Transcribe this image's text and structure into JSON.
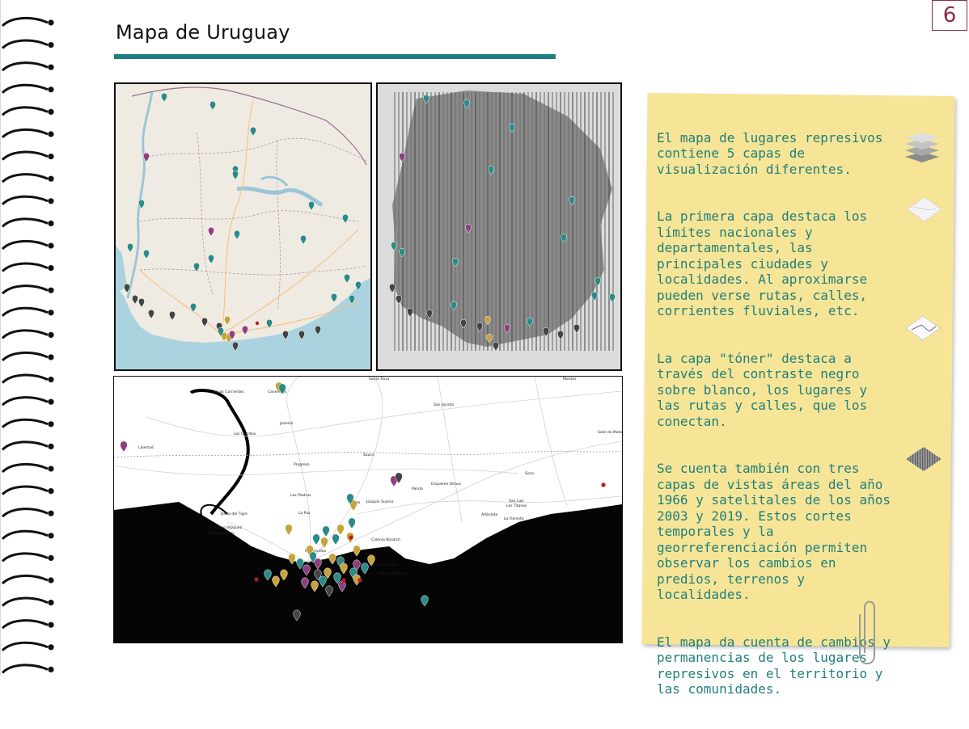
{
  "header": {
    "title": "Mapa de Uruguay",
    "page_number": "6"
  },
  "colors": {
    "accent_teal": "#1f8080",
    "page_number_border": "#8a2c4a",
    "note_background": "#f7e597",
    "note_text": "#1f7f7c",
    "marker_teal": "#2b8b88",
    "marker_purple": "#8e3f7f",
    "marker_gold": "#c8a23a",
    "marker_dark": "#444444"
  },
  "maps": {
    "dark_map_labels": {
      "santa_rosa": "Santa Rosa",
      "montes": "Montes",
      "aguas_corrientes": "Aguas Corrientes",
      "canelones": "Canelones",
      "san_jacinto": "San Jacinto",
      "joanico": "Joanicó",
      "los_cerrillos": "Los Cerrillos",
      "libertad": "Libertad",
      "sauce": "Sauce",
      "soltaDeMatas": "Solís de Mataojo",
      "progreso": "Progreso",
      "empalme_olmos": "Empalme Olmos",
      "pando": "Pando",
      "soca": "Soca",
      "las_piedras": "Las Piedras",
      "joaquin_suarez": "Joaquín Suárez",
      "toledo": "Toledo",
      "la_paz": "La Paz",
      "san_luis": "San Luis",
      "los_titanes": "Los Titanes",
      "delta_del_tigre": "Delta del Tigre",
      "santiago_vazquez": "Santiago Vázquez",
      "pajas_blancas": "Pajas Blancas",
      "atlantida": "Atlántida",
      "la_floresta": "La Floresta",
      "colonia_nicolich": "Colonia Nicolich",
      "montevideo": "Montevideo",
      "paso_de_carrasco": "Paso de Carrasco",
      "barros_blancos": "Barros Blancos"
    }
  },
  "note": {
    "paragraphs": [
      "El mapa de lugares represivos\ncontiene 5 capas de\nvisualización diferentes.",
      "La primera capa destaca los\nlímites nacionales   y\ndepartamentales, las\nprincipales ciudades y\nlocalidades. Al aproximarse\npueden verse rutas, calles,\ncorrientes fluviales, etc.",
      "La capa \"tóner\" destaca  a\ntravés del contraste negro\nsobre blanco, los lugares y\nlas rutas y calles, que los\nconectan.",
      "Se cuenta también con tres\ncapas de vistas áreas del año\n1966 y satelitales de los años\n2003 y 2019. Estos cortes\ntemporales y la\ngeorreferenciación permiten\nobservar los cambios en\npredios, terrenos y\nlocalidades.",
      "El mapa da cuenta de cambios y\npermanencias  de los lugares\nrepresivos en el territorio y\nlas comunidades."
    ]
  },
  "icons": {
    "layers": "layers-icon",
    "base_map_thumb": "map-thumbnail-icon",
    "toner_thumb": "toner-thumbnail-icon",
    "aerial_thumb": "aerial-thumbnail-icon",
    "paperclip": "paperclip-icon",
    "spiral": "spiral-binding"
  }
}
